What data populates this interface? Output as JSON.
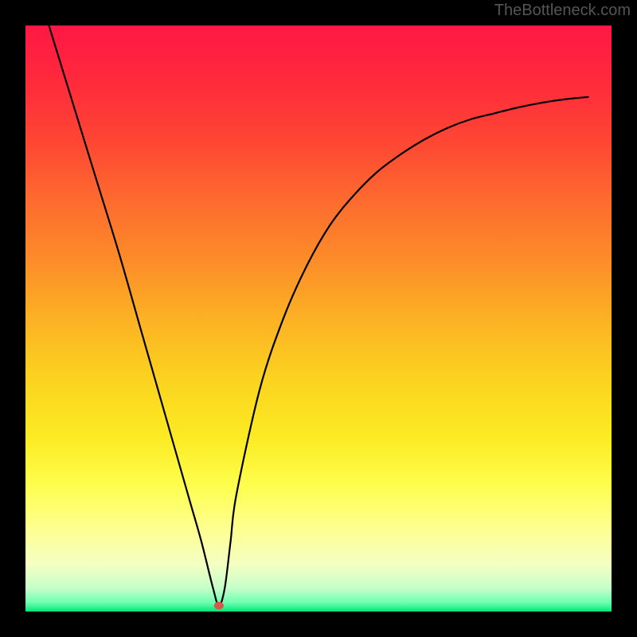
{
  "watermark": "TheBottleneck.com",
  "chart_data": {
    "type": "line",
    "title": "",
    "xlabel": "",
    "ylabel": "",
    "xlim": [
      0,
      100
    ],
    "ylim": [
      0,
      100
    ],
    "axes_visible": false,
    "grid": false,
    "background_gradient": {
      "direction": "vertical",
      "stops": [
        {
          "pos": 0.0,
          "color": "#ff1744"
        },
        {
          "pos": 0.1,
          "color": "#ff2b3b"
        },
        {
          "pos": 0.2,
          "color": "#fe4733"
        },
        {
          "pos": 0.3,
          "color": "#fd6b2e"
        },
        {
          "pos": 0.4,
          "color": "#fc8c29"
        },
        {
          "pos": 0.5,
          "color": "#fcb124"
        },
        {
          "pos": 0.6,
          "color": "#fbd21f"
        },
        {
          "pos": 0.7,
          "color": "#fcea22"
        },
        {
          "pos": 0.78,
          "color": "#fdfd4a"
        },
        {
          "pos": 0.86,
          "color": "#feff91"
        },
        {
          "pos": 0.92,
          "color": "#f3ffc3"
        },
        {
          "pos": 0.96,
          "color": "#c6ffc9"
        },
        {
          "pos": 0.985,
          "color": "#6cffb0"
        },
        {
          "pos": 1.0,
          "color": "#00e676"
        }
      ]
    },
    "border_color": "#000000",
    "border_width_px": 32,
    "series": [
      {
        "name": "bottleneck-curve",
        "color": "#000000",
        "stroke_width_px": 2.2,
        "x": [
          4,
          8,
          12,
          16,
          20,
          24,
          28,
          30,
          32,
          33,
          34,
          35,
          36,
          40,
          44,
          48,
          52,
          56,
          60,
          64,
          68,
          72,
          76,
          80,
          84,
          88,
          92,
          96
        ],
        "y": [
          100,
          87,
          74,
          61,
          47,
          33,
          19,
          12,
          4,
          1,
          4,
          12,
          20,
          38,
          50,
          59,
          66,
          71,
          75,
          78,
          80.5,
          82.5,
          84,
          85,
          86,
          86.8,
          87.4,
          87.8
        ]
      }
    ],
    "markers": [
      {
        "name": "bottleneck-min-marker",
        "x": 33,
        "y": 1,
        "rx": 6,
        "ry": 5,
        "color": "#d35a4a"
      }
    ]
  }
}
